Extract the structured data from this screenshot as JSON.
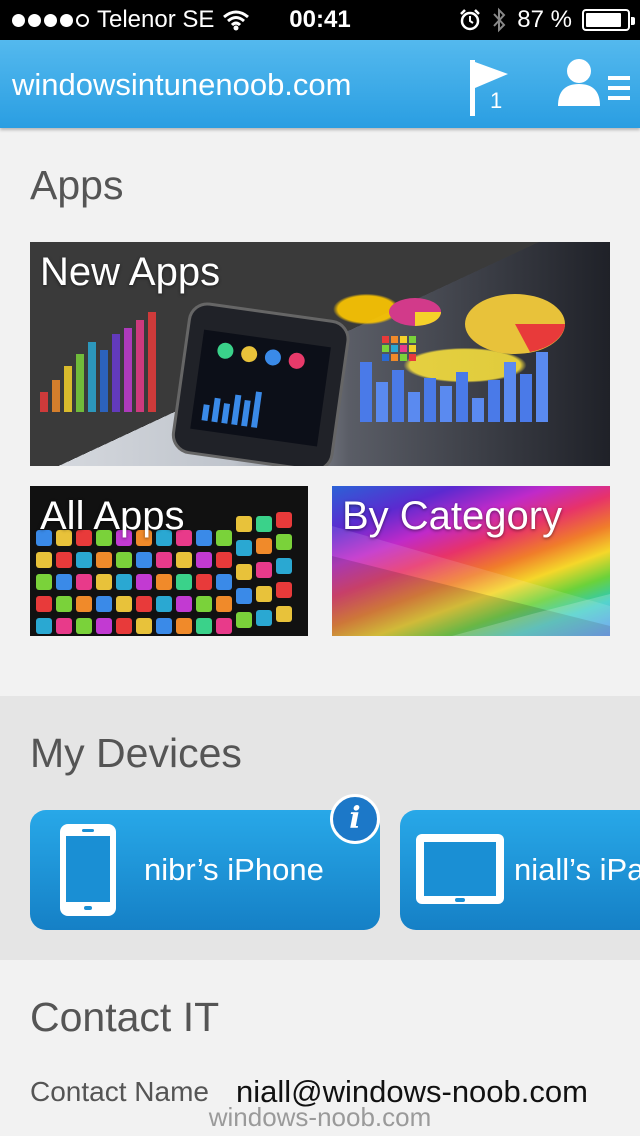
{
  "status_bar": {
    "carrier": "Telenor SE",
    "time": "00:41",
    "battery": "87 %",
    "battery_level": 0.87,
    "icons": [
      "signal-dots",
      "wifi-icon",
      "alarm-icon",
      "bluetooth-icon",
      "battery-icon"
    ]
  },
  "navbar": {
    "title": "windowsintunenoob.com",
    "flag_badge": "1",
    "icons": [
      "flag-icon",
      "user-menu-icon"
    ]
  },
  "apps": {
    "title": "Apps",
    "tiles": [
      {
        "label": "New Apps"
      },
      {
        "label": "All Apps"
      },
      {
        "label": "By Category"
      }
    ]
  },
  "devices": {
    "title": "My Devices",
    "items": [
      {
        "name": "nibr’s iPhone",
        "type": "phone"
      },
      {
        "name": "niall’s iPad",
        "type": "tablet"
      }
    ],
    "info_glyph": "i"
  },
  "contact": {
    "title": "Contact IT",
    "name_label": "Contact Name",
    "name_value": "niall@windows-noob.com"
  },
  "watermark": "windows-noob.com",
  "colors": {
    "accent": "#2a9ee2",
    "device_button": "#1a8fd4"
  }
}
